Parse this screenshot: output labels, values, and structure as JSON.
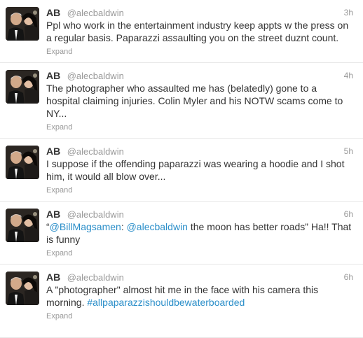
{
  "tweets": [
    {
      "fullname": "AB",
      "username": "@alecbaldwin",
      "time": "3h",
      "text": "Ppl who work in the entertainment industry keep appts w the press on a regular basis. Paparazzi assaulting you on the street duznt count.",
      "expand": "Expand"
    },
    {
      "fullname": "AB",
      "username": "@alecbaldwin",
      "time": "4h",
      "text": "The photographer who assaulted me has (belatedly) gone to a hospital claiming injuries. Colin Myler and his NOTW scams come to NY...",
      "expand": "Expand"
    },
    {
      "fullname": "AB",
      "username": "@alecbaldwin",
      "time": "5h",
      "text": "I suppose if the offending paparazzi was wearing a hoodie and I shot him, it would all blow over...",
      "expand": "Expand"
    },
    {
      "fullname": "AB",
      "username": "@alecbaldwin",
      "time": "6h",
      "text_open_quote": "“",
      "mention1": "@BillMagsamen",
      "text_mid1": ": ",
      "mention2": "@alecbaldwin",
      "text_mid2": " the moon has better roads” Ha!! That is funny",
      "expand": "Expand"
    },
    {
      "fullname": "AB",
      "username": "@alecbaldwin",
      "time": "6h",
      "text": "A \"photographer\" almost hit me in the face with his camera this morning. ",
      "hashtag": "#allpaparazzishouldbewaterboarded",
      "expand": "Expand"
    }
  ],
  "colors": {
    "link": "#2a8ec9",
    "muted": "#999999",
    "text": "#333333",
    "divider": "#e8e8e8"
  }
}
